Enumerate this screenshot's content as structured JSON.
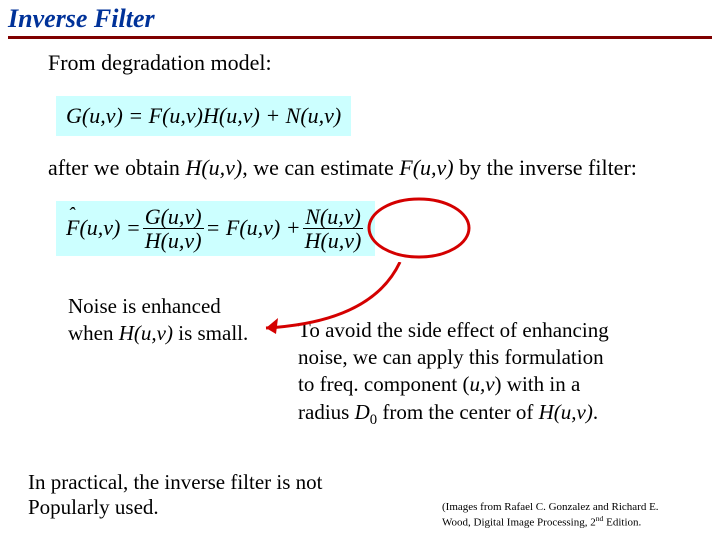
{
  "title": "Inverse Filter",
  "line1": "From degradation model:",
  "eq1": {
    "lhs": "G(u,v) =",
    "rhs": "F(u,v)H(u,v) + N(u,v)"
  },
  "line2_pre": "after we obtain ",
  "line2_H": "H(u,v)",
  "line2_mid": ", we can estimate ",
  "line2_F": "F(u,v)",
  "line2_post": " by the inverse filter:",
  "eq2": {
    "lhs": "F̂(u,v) =",
    "frac1_num": "G(u,v)",
    "frac1_den": "H(u,v)",
    "mid": "= F(u,v) +",
    "frac2_num": "N(u,v)",
    "frac2_den": "H(u,v)"
  },
  "noise_l1": "Noise is enhanced",
  "noise_l2_pre": "when ",
  "noise_l2_H": "H(u,v)",
  "noise_l2_post": " is small.",
  "avoid_l1": "To avoid the side effect of enhancing",
  "avoid_l2": "noise, we can apply this formulation",
  "avoid_l3_pre": "to freq. component (",
  "avoid_l3_uv": "u,v",
  "avoid_l3_post": ") with in a",
  "avoid_l4_pre": "radius ",
  "avoid_l4_D": "D",
  "avoid_l4_sub": "0",
  "avoid_l4_mid": " from the center of ",
  "avoid_l4_H": "H(u,v)",
  "avoid_l4_end": ".",
  "practical_l1": "In practical, the inverse filter is not",
  "practical_l2": "Popularly used.",
  "credit_l1": "(Images from Rafael C. Gonzalez and Richard E.",
  "credit_l2_pre": "Wood, Digital Image Processing, 2",
  "credit_l2_sup": "nd",
  "credit_l2_post": " Edition."
}
